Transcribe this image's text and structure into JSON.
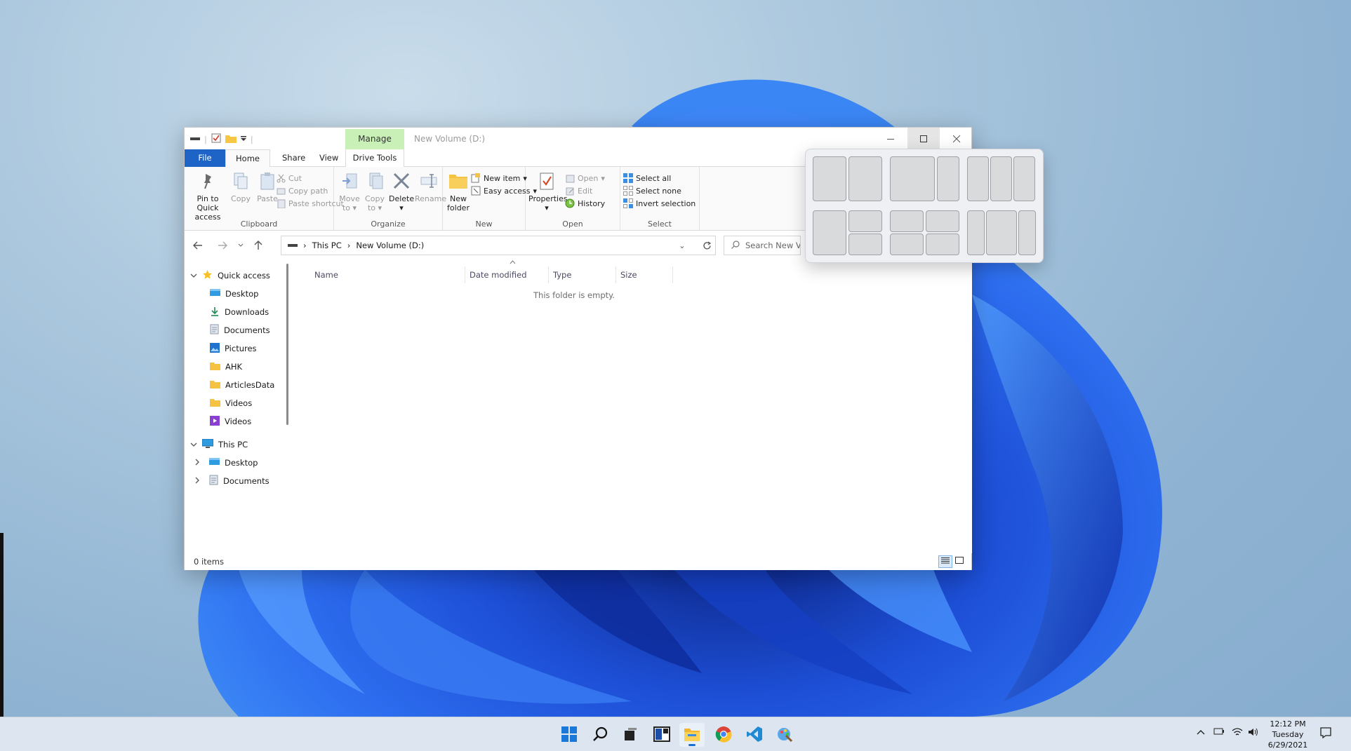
{
  "window": {
    "title": "New Volume (D:)",
    "contextual_tab": "Manage",
    "contextual_subtab": "Drive Tools",
    "tabs": {
      "file": "File",
      "home": "Home",
      "share": "Share",
      "view": "View"
    }
  },
  "ribbon": {
    "clipboard": {
      "label": "Clipboard",
      "pin_line1": "Pin to Quick",
      "pin_line2": "access",
      "copy": "Copy",
      "paste": "Paste",
      "cut": "Cut",
      "copy_path": "Copy path",
      "paste_shortcut": "Paste shortcut"
    },
    "organize": {
      "label": "Organize",
      "move_line1": "Move",
      "move_line2": "to",
      "copy_line1": "Copy",
      "copy_line2": "to",
      "delete": "Delete",
      "rename": "Rename"
    },
    "new": {
      "label": "New",
      "folder_line1": "New",
      "folder_line2": "folder",
      "new_item": "New item",
      "easy_access": "Easy access"
    },
    "open": {
      "label": "Open",
      "properties": "Properties",
      "open": "Open",
      "edit": "Edit",
      "history": "History"
    },
    "select": {
      "label": "Select",
      "select_all": "Select all",
      "select_none": "Select none",
      "invert": "Invert selection"
    }
  },
  "address": {
    "crumbs": [
      "This PC",
      "New Volume (D:)"
    ],
    "search_placeholder": "Search New Vo"
  },
  "nav": {
    "quick_access": "Quick access",
    "items": [
      "Desktop",
      "Downloads",
      "Documents",
      "Pictures",
      "AHK",
      "ArticlesData",
      "Videos",
      "Videos"
    ],
    "this_pc": "This PC",
    "pc_items": [
      "Desktop",
      "Documents"
    ]
  },
  "columns": [
    "Name",
    "Date modified",
    "Type",
    "Size"
  ],
  "empty_message": "This folder is empty.",
  "status": {
    "items": "0 items"
  },
  "clock": {
    "time": "12:12 PM",
    "day": "Tuesday",
    "date": "6/29/2021"
  },
  "colors": {
    "accent": "#1d64c6",
    "manage_tab": "#c9f0b6",
    "taskbar": "#dde6f0"
  },
  "taskbar_icons": [
    "start-icon",
    "search-icon",
    "task-view-icon",
    "widgets-icon",
    "file-explorer-icon",
    "chrome-icon",
    "vscode-icon",
    "paint-icon"
  ]
}
